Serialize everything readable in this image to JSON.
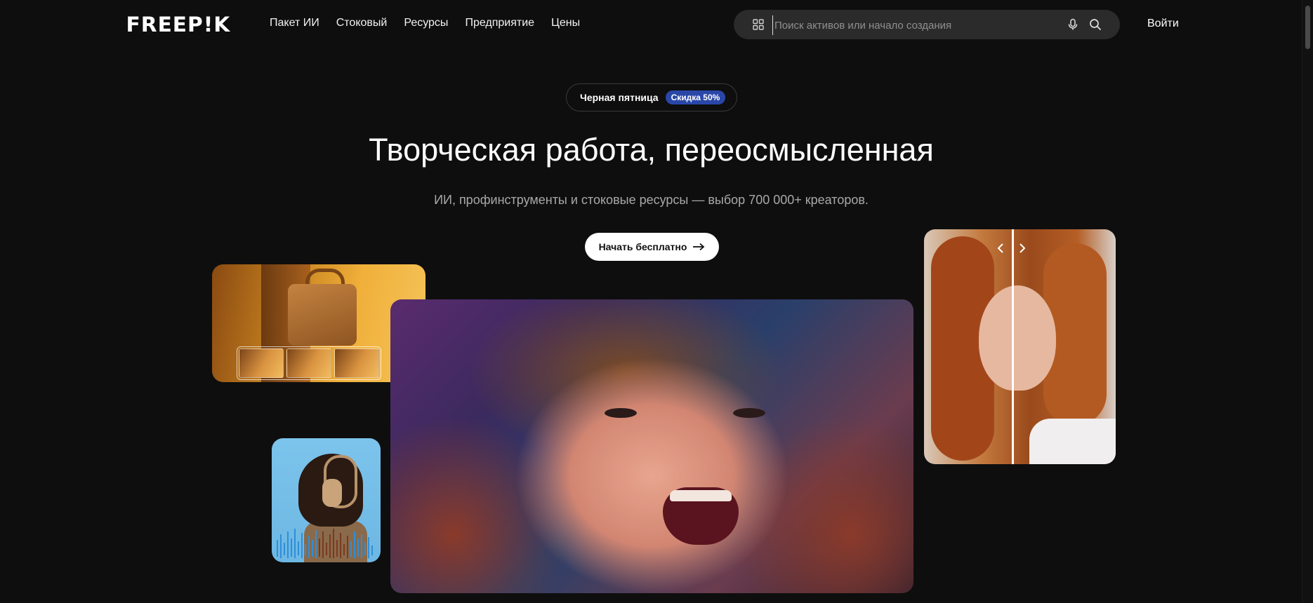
{
  "header": {
    "logo": "FREEP!K",
    "nav": [
      "Пакет ИИ",
      "Стоковый",
      "Ресурсы",
      "Предприятие",
      "Цены"
    ],
    "search_placeholder": "Поиск активов или начало создания",
    "login_label": "Войти"
  },
  "hero": {
    "promo_label": "Черная пятница",
    "promo_badge": "Скидка 50%",
    "title": "Творческая работа, переосмысленная",
    "subtitle": "ИИ, профинструменты и стоковые ресурсы — выбор 700 000+ креаторов.",
    "cta_label": "Начать бесплатно"
  },
  "colors": {
    "background": "#0e0e0e",
    "badge": "#2a47a8",
    "cta_bg": "#ffffff"
  },
  "icons": [
    "grid-icon",
    "mic-icon",
    "search-icon",
    "arrow-right-icon",
    "chevron-left-icon",
    "chevron-right-icon"
  ]
}
